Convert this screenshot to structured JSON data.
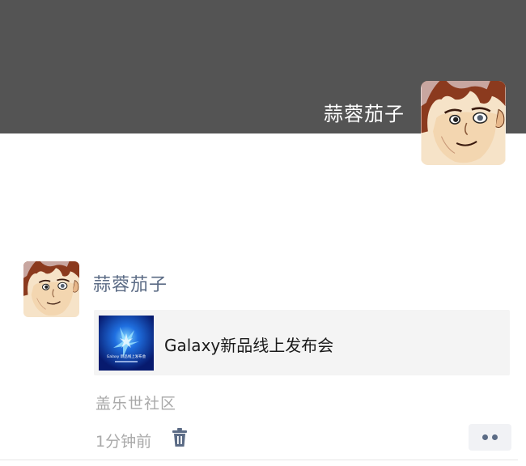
{
  "cover": {
    "user_name": "蒜蓉茄子",
    "background_color": "#545454"
  },
  "post": {
    "user_name": "蒜蓉茄子",
    "share_card": {
      "title": "Galaxy新品线上发布会",
      "thumbnail_caption": "Galaxy 新品线上发布会"
    },
    "source": "盖乐世社区",
    "timestamp": "1分钟前",
    "icons": {
      "delete": "trash-icon",
      "more": "more-dots-icon"
    }
  },
  "colors": {
    "name_link": "#5b6b85",
    "secondary_text": "#a9a9a9",
    "card_background": "#f4f4f4"
  }
}
